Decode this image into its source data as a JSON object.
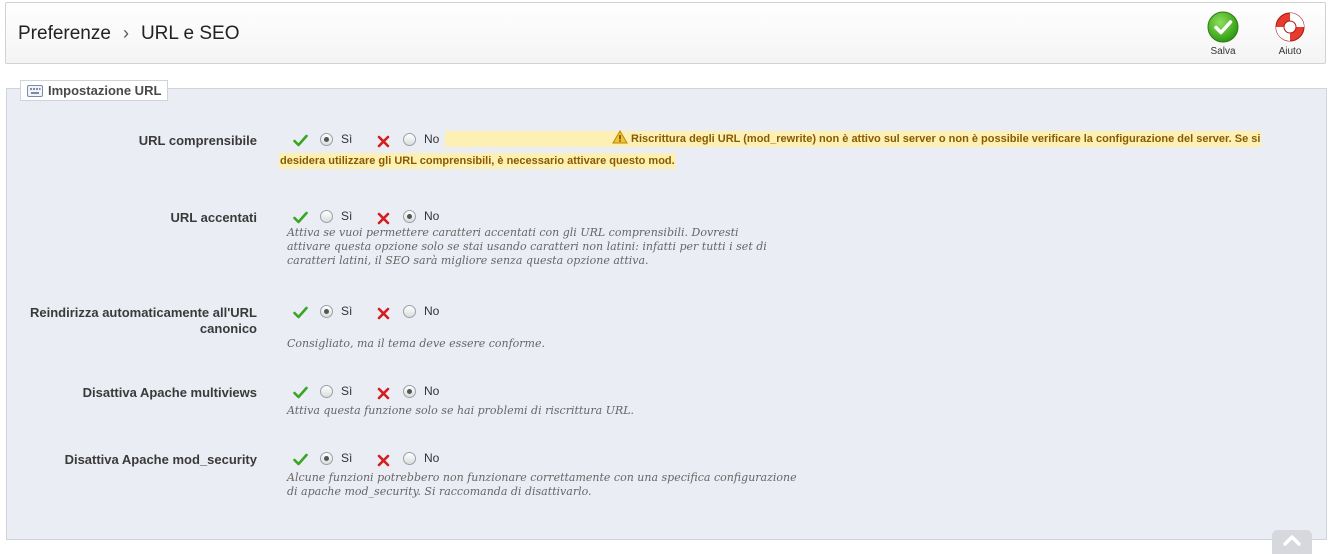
{
  "header": {
    "breadcrumb": [
      "Preferenze",
      "URL e SEO"
    ],
    "separator": "›",
    "save_label": "Salva",
    "help_label": "Aiuto"
  },
  "panel": {
    "legend": "Impostazione URL"
  },
  "options_labels": {
    "yes": "Sì",
    "no": "No"
  },
  "fields": [
    {
      "label": "URL comprensibile",
      "selected": "yes",
      "warning": "Riscrittura degli URL (mod_rewrite) non è attivo sul server o non è possibile verificare la configurazione del server. Se si desidera utilizzare gli URL comprensibili, è necessario attivare questo mod."
    },
    {
      "label": "URL accentati",
      "selected": "no",
      "help": "Attiva se vuoi permettere caratteri accentati con gli URL comprensibili. Dovresti attivare questa opzione solo se stai usando caratteri non latini: infatti per tutti i set di caratteri latini, il SEO sarà migliore senza questa opzione attiva."
    },
    {
      "label": "Reindirizza automaticamente all'URL canonico",
      "selected": "yes",
      "help": "Consigliato, ma il tema deve essere conforme."
    },
    {
      "label": "Disattiva Apache multiviews",
      "selected": "no",
      "help": "Attiva questa funzione solo se hai problemi di riscrittura URL."
    },
    {
      "label": "Disattiva Apache mod_security",
      "selected": "yes",
      "help": "Alcune funzioni potrebbero non funzionare correttamente con una specifica configurazione di apache mod_security. Si raccomanda di disattivarlo."
    }
  ],
  "colors": {
    "yes_check": "#3aa521",
    "no_cross": "#d21f1f",
    "warning_bg": "#fdf0b5",
    "panel_bg": "#ebedf4"
  }
}
